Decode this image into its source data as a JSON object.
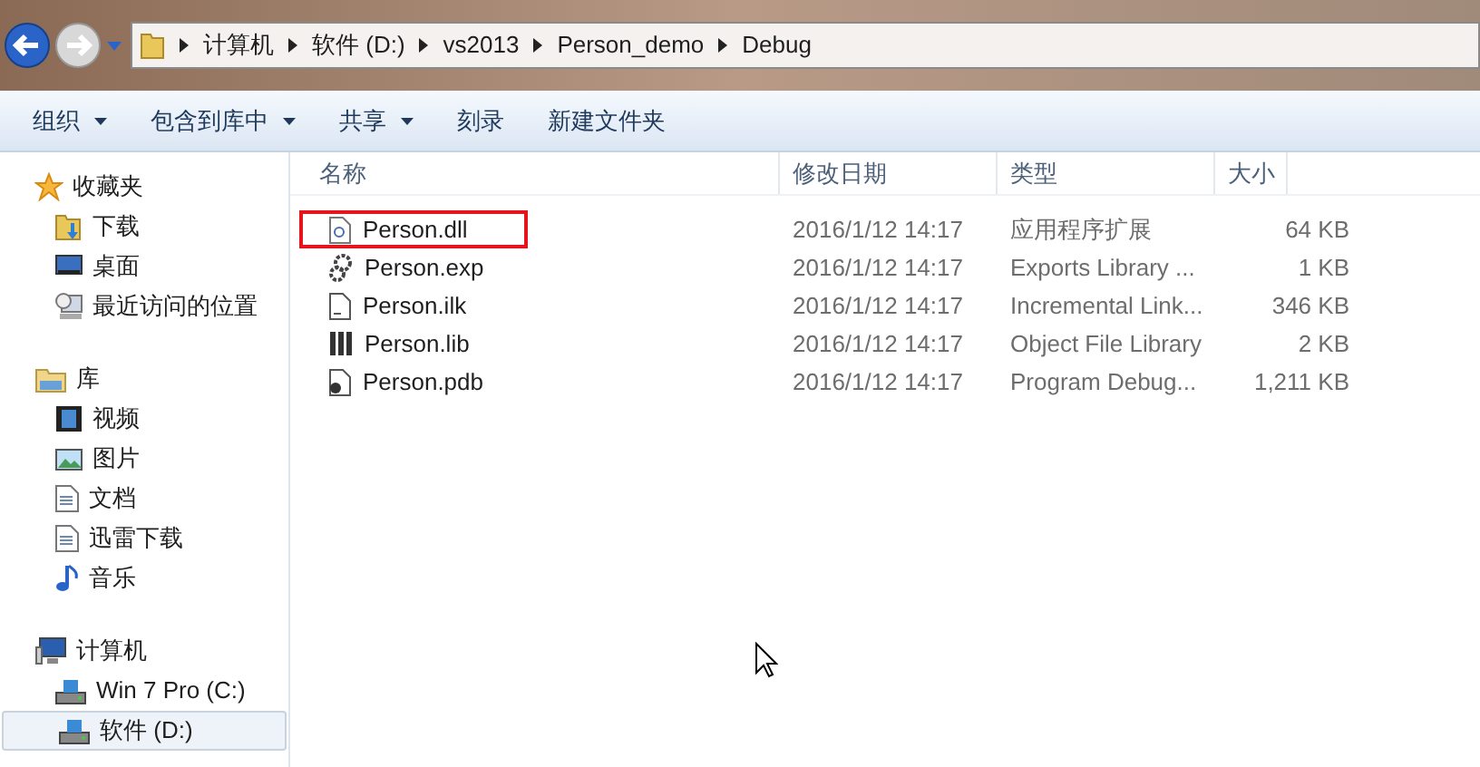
{
  "address_bar": {
    "path": [
      {
        "label": "计算机"
      },
      {
        "label": "软件 (D:)"
      },
      {
        "label": "vs2013"
      },
      {
        "label": "Person_demo"
      },
      {
        "label": "Debug"
      }
    ]
  },
  "toolbar": [
    {
      "label": "组织",
      "dropdown": true
    },
    {
      "label": "包含到库中",
      "dropdown": true
    },
    {
      "label": "共享",
      "dropdown": true
    },
    {
      "label": "刻录",
      "dropdown": false
    },
    {
      "label": "新建文件夹",
      "dropdown": false
    }
  ],
  "sidebar": {
    "groups": [
      {
        "label": "收藏夹",
        "kind": "favorites",
        "children": [
          {
            "label": "下载",
            "kind": "download",
            "selected": false
          },
          {
            "label": "桌面",
            "kind": "desktop",
            "selected": false
          },
          {
            "label": "最近访问的位置",
            "kind": "recent",
            "selected": false
          }
        ]
      },
      {
        "label": "库",
        "kind": "library",
        "children": [
          {
            "label": "视频",
            "kind": "video",
            "selected": false
          },
          {
            "label": "图片",
            "kind": "picture",
            "selected": false
          },
          {
            "label": "文档",
            "kind": "document",
            "selected": false
          },
          {
            "label": "迅雷下载",
            "kind": "document",
            "selected": false
          },
          {
            "label": "音乐",
            "kind": "music",
            "selected": false
          }
        ]
      },
      {
        "label": "计算机",
        "kind": "computer",
        "children": [
          {
            "label": "Win 7 Pro (C:)",
            "kind": "drive",
            "selected": false
          },
          {
            "label": "软件 (D:)",
            "kind": "drive",
            "selected": true
          }
        ]
      }
    ]
  },
  "table": {
    "columns": [
      "名称",
      "修改日期",
      "类型",
      "大小"
    ],
    "rows": [
      {
        "name": "Person.dll",
        "kind": "dll",
        "modified": "2016/1/12 14:17",
        "type": "应用程序扩展",
        "size": "64 KB",
        "highlighted": true
      },
      {
        "name": "Person.exp",
        "kind": "exp",
        "modified": "2016/1/12 14:17",
        "type": "Exports Library ...",
        "size": "1 KB",
        "highlighted": false
      },
      {
        "name": "Person.ilk",
        "kind": "ilk",
        "modified": "2016/1/12 14:17",
        "type": "Incremental Link...",
        "size": "346 KB",
        "highlighted": false
      },
      {
        "name": "Person.lib",
        "kind": "lib",
        "modified": "2016/1/12 14:17",
        "type": "Object File Library",
        "size": "2 KB",
        "highlighted": false
      },
      {
        "name": "Person.pdb",
        "kind": "pdb",
        "modified": "2016/1/12 14:17",
        "type": "Program Debug...",
        "size": "1,211 KB",
        "highlighted": false
      }
    ]
  }
}
